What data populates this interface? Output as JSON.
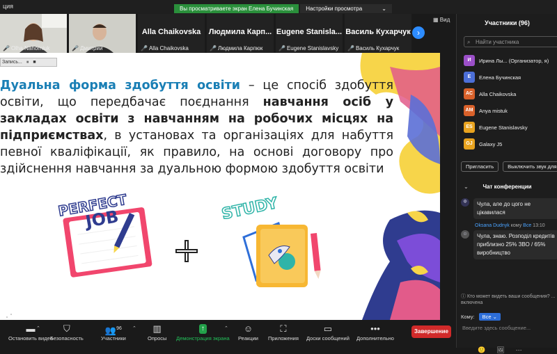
{
  "window": {
    "title_fragment": "ция"
  },
  "share_banner": {
    "message": "Вы просматриваете экран Елена Бучинская",
    "options_label": "Настройки просмотра",
    "options_chevron": "⌄"
  },
  "view_button": {
    "label": "Вид",
    "icon": "grid-icon"
  },
  "video_tiles": [
    {
      "name": "Olha Nahorniuk",
      "has_video": true
    },
    {
      "name": "Дмитрий",
      "has_video": true
    },
    {
      "display_name": "Alla Chaikovska",
      "name": "Alla Chaikovska",
      "has_video": false
    },
    {
      "display_name": "Людмила Карп...",
      "name": "Людмила Карпюк",
      "has_video": false
    },
    {
      "display_name": "Eugene Stanisla...",
      "name": "Eugene Stanislavsky",
      "has_video": false
    },
    {
      "display_name": "Василь Кухарчук",
      "name": "Василь Кухарчук",
      "has_video": false
    }
  ],
  "recording_bar": {
    "label": "Запись...",
    "pause_icon": "⏸",
    "stop_icon": "■"
  },
  "slide": {
    "t1": "Дуальна форма здобуття освіти",
    "t2": " – це спосіб здобуття освіти, що передбачає поєднання ",
    "t3": "навчання осіб у закладах освіти з навчанням на робочих місцях на підприємствах",
    "t4": ", в установах та організаціях для набуття певної кваліфікації, як правило, на основі договору про здійснення навчання за дуальною формою здобуття освіти",
    "sticker1_line1": "PERFECT",
    "sticker1_line2": "JOB",
    "plus": "+",
    "sticker2": "STUDY"
  },
  "participants_panel": {
    "title": "Участники (96)",
    "search_placeholder": "Найти участника",
    "items": [
      {
        "initials": "И",
        "name": "Ирина Лы...  (Организатор, я)",
        "color": "#9b4fc8"
      },
      {
        "initials": "Е",
        "name": "Елена Бучинская",
        "color": "#4c6fd8"
      },
      {
        "initials": "AC",
        "name": "Alla Chaikovska",
        "color": "#d9612a"
      },
      {
        "initials": "AM",
        "name": "Anya mistuk",
        "color": "#d9612a"
      },
      {
        "initials": "ES",
        "name": "Eugene Stanislavsky",
        "color": "#e8a31f"
      },
      {
        "initials": "GJ",
        "name": "Galaxy J5",
        "color": "#e8a31f"
      }
    ],
    "invite_label": "Пригласить",
    "mute_all_label": "Выключить звук для в"
  },
  "chat": {
    "title": "Чат конференции",
    "messages": [
      {
        "avatar": "Ф",
        "text": "Чула, але до цого не цікавилася"
      },
      {
        "sender": "Oksana Dudnyk",
        "to_word": "кому",
        "recipient": "Все",
        "time": "13:10",
        "text": "Чула, знаю.  Розподіл кредитів приблизно  25% ЗВО / 65% виробництво"
      }
    ],
    "visibility_note": "Кто может видеть ваши сообщения? ... включена",
    "to_label": "Кому:",
    "to_value": "Все",
    "input_placeholder": "Введите здесь сообщение...",
    "tool_icons": [
      "🙂",
      "🖼",
      "⋯"
    ]
  },
  "toolbar": {
    "items": [
      {
        "label": "Остановить видео",
        "icon": "video-camera-icon"
      },
      {
        "label": "Безопасность",
        "icon": "shield-icon"
      },
      {
        "label": "Участники",
        "icon": "people-icon",
        "badge": "96"
      },
      {
        "label": "Опросы",
        "icon": "bar-chart-icon"
      },
      {
        "label": "Демонстрация экрана",
        "icon": "share-screen-icon"
      },
      {
        "label": "Реакции",
        "icon": "emoji-icon"
      },
      {
        "label": "Приложения",
        "icon": "apps-icon"
      },
      {
        "label": "Доски сообщений",
        "icon": "whiteboard-icon"
      },
      {
        "label": "Дополнительно",
        "icon": "more-icon"
      }
    ],
    "end_label": "Завершение"
  },
  "colors": {
    "accent": "#2d8cff",
    "share_green": "#23a14a",
    "end_red": "#d12a2a",
    "slide_highlight": "#1a7fb5"
  }
}
